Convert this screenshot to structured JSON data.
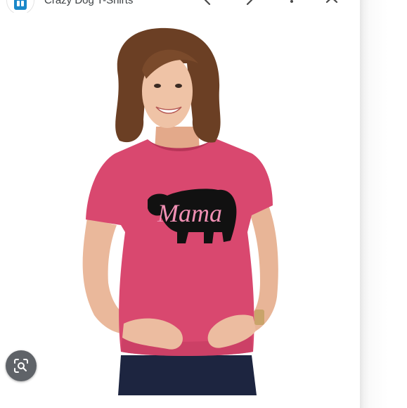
{
  "header": {
    "source_title": "Crazy Dog T-Shirts",
    "logo_icon": "crazy-dog-logo-icon",
    "prev_icon": "chevron-left-icon",
    "next_icon": "chevron-right-icon",
    "more_icon": "more-vert-icon",
    "close_icon": "close-icon"
  },
  "product_image": {
    "shirt_text": "Mama",
    "shirt_color": "#d9486f",
    "print_color": "#111111",
    "lettering_color": "#f08fb3"
  },
  "overlay": {
    "lens_icon": "visual-search-icon"
  }
}
